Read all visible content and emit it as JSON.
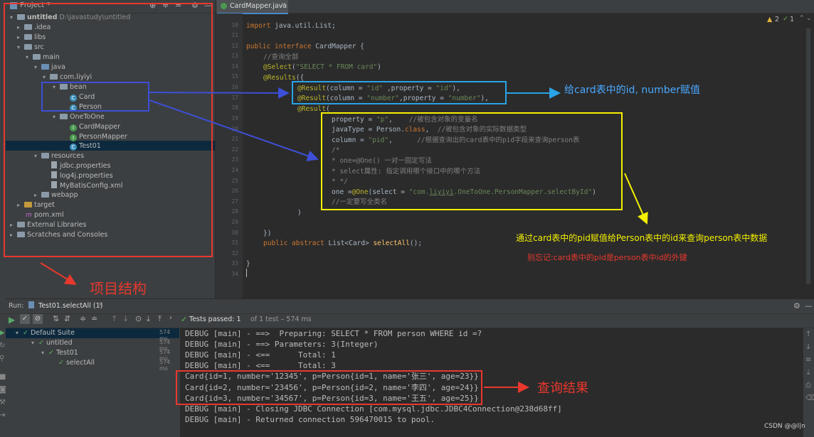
{
  "project": {
    "header_label": "Project",
    "tree": [
      {
        "label": "untitled",
        "extra": "D:\\javastudy\\untitled",
        "icon": "folder",
        "expanded": true
      },
      {
        "label": ".idea",
        "icon": "folder",
        "expanded": false
      },
      {
        "label": "libs",
        "icon": "folder",
        "expanded": false
      },
      {
        "label": "src",
        "icon": "folder",
        "expanded": true
      },
      {
        "label": "main",
        "icon": "folder",
        "expanded": true
      },
      {
        "label": "java",
        "icon": "folder-blue",
        "expanded": true
      },
      {
        "label": "com.liyiyi",
        "icon": "package",
        "expanded": true
      },
      {
        "label": "bean",
        "icon": "package",
        "expanded": true
      },
      {
        "label": "Card",
        "icon": "class"
      },
      {
        "label": "Person",
        "icon": "class"
      },
      {
        "label": "OneToOne",
        "icon": "package",
        "expanded": true
      },
      {
        "label": "CardMapper",
        "icon": "interface"
      },
      {
        "label": "PersonMapper",
        "icon": "interface"
      },
      {
        "label": "Test01",
        "icon": "class",
        "selected": true
      },
      {
        "label": "resources",
        "icon": "folder",
        "expanded": true
      },
      {
        "label": "jdbc.properties",
        "icon": "file"
      },
      {
        "label": "log4j.properties",
        "icon": "file"
      },
      {
        "label": "MyBatisConfig.xml",
        "icon": "file"
      },
      {
        "label": "webapp",
        "icon": "folder",
        "expanded": false
      },
      {
        "label": "target",
        "icon": "folder-orange",
        "expanded": false
      },
      {
        "label": "pom.xml",
        "icon": "maven"
      },
      {
        "label": "External Libraries",
        "icon": "library",
        "expanded": false
      },
      {
        "label": "Scratches and Consoles",
        "icon": "scratch",
        "expanded": false
      }
    ]
  },
  "editor": {
    "tab_label": "CardMapper.java",
    "inspection": {
      "warnings": "2",
      "checks": "1"
    },
    "line_numbers": [
      "10",
      "11",
      "12",
      "13",
      "14",
      "15",
      "16",
      "17",
      "18",
      "19",
      "20",
      "21",
      "22",
      "23",
      "24",
      "25",
      "26",
      "27",
      "28",
      "29",
      "30",
      "31",
      "32",
      "33",
      "34"
    ]
  },
  "annotations": {
    "blue_note": "给card表中的id, number赋值",
    "yellow_note": "通过card表中的pid赋值给Person表中的id来查询person表中数据",
    "red_note_small": "别忘记:card表中的pid是person表中id的外键",
    "project_structure": "项目结构",
    "query_result": "查询结果"
  },
  "run": {
    "label": "Run:",
    "tab_label": "Test01.selectAll (1)",
    "tests_passed": "Tests passed: 1",
    "tests_summary": "of 1 test – 574 ms",
    "suite": [
      {
        "label": "Default Suite",
        "time": "574 ms"
      },
      {
        "label": "untitled",
        "time": "574 ms"
      },
      {
        "label": "Test01",
        "time": "574 ms"
      },
      {
        "label": "selectAll",
        "time": "574 ms"
      }
    ],
    "console": [
      "DEBUG [main] - ==>  Preparing: SELECT * FROM person WHERE id =?",
      "DEBUG [main] - ==> Parameters: 3(Integer)",
      "DEBUG [main] - <==      Total: 1",
      "DEBUG [main] - <==      Total: 3",
      "Card{id=1, number='12345', p=Person{id=1, name='张三', age=23}}",
      "Card{id=2, number='23456', p=Person{id=2, name='李四', age=24}}",
      "Card{id=3, number='34567', p=Person{id=3, name='王五', age=25}}",
      "DEBUG [main] - Closing JDBC Connection [com.mysql.jdbc.JDBC4Connection@238d68ff]",
      "DEBUG [main] - Returned connection 596470015 to pool."
    ]
  },
  "watermark": "CSDN @@l|n",
  "colors": {
    "red": "#e8382e",
    "blue_box": "#29a3e6",
    "indigo_box": "#3d4fd6",
    "yellow": "#f4f000",
    "note_blue": "#4aa8ff"
  }
}
